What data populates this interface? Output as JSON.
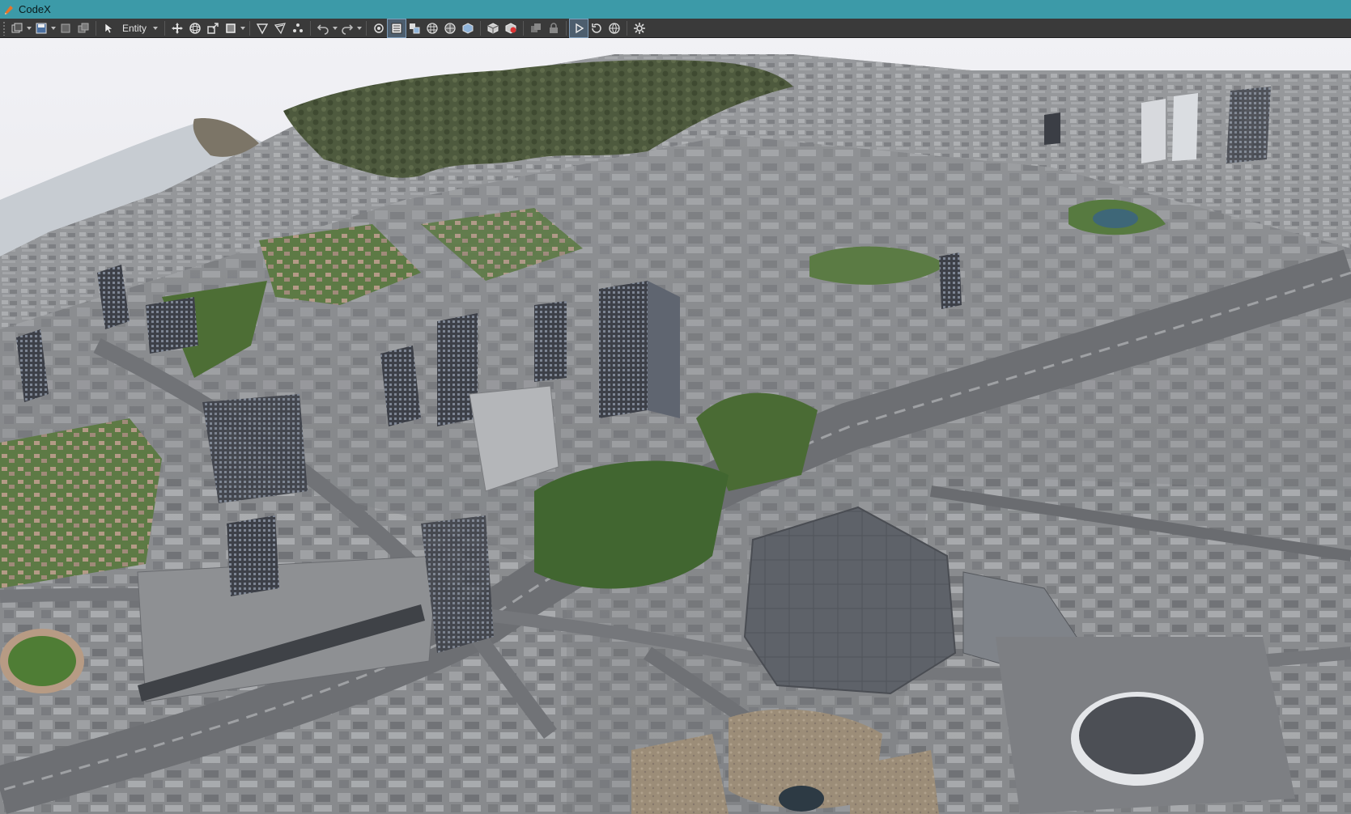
{
  "window": {
    "title": "CodeX"
  },
  "toolbar": {
    "mode_label": "Entity",
    "groups": [
      [
        "new-entity",
        "save",
        "save-all",
        "copy"
      ],
      [
        "select",
        "mode"
      ],
      [
        "move",
        "rotate",
        "scale",
        "bounds"
      ],
      [
        "terrain-paint",
        "vegetation-paint",
        "vertex-edit"
      ],
      [
        "undo",
        "redo"
      ],
      [
        "camera-orbit",
        "properties",
        "layers",
        "grid",
        "snapping",
        "physics"
      ],
      [
        "create-object",
        "delete-object"
      ],
      [
        "duplicate",
        "lock"
      ],
      [
        "play",
        "reset",
        "world-globe"
      ],
      [
        "settings"
      ]
    ]
  },
  "colors": {
    "titlebar": "#3c9aa8",
    "toolbar": "#3a3a3a",
    "sky": "#e9e9ee",
    "water": "#b7bfc8",
    "hills": "#4e5a3e",
    "ground": "#8a8c8f",
    "grass": "#3f6a2c",
    "arena_roof": "#5d6168"
  }
}
